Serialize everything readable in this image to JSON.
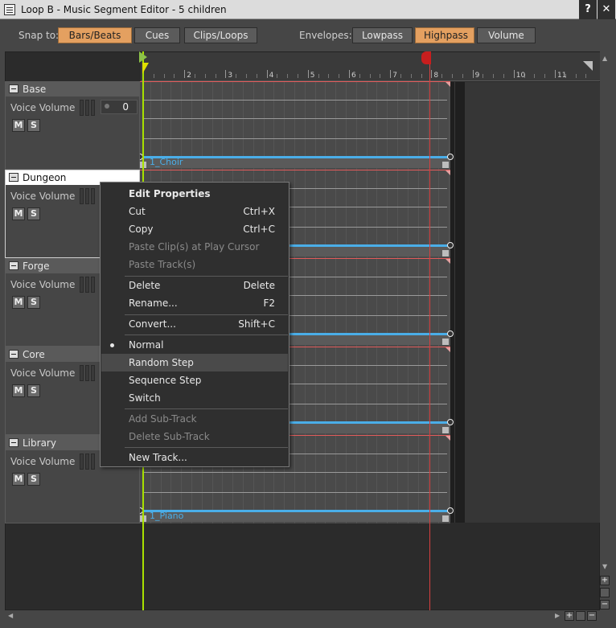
{
  "window": {
    "title": "Loop B - Music Segment Editor - 5 children",
    "help_label": "?",
    "close_label": "✕"
  },
  "toolbar": {
    "snap_label": "Snap to:",
    "snap_options": [
      "Bars/Beats",
      "Cues",
      "Clips/Loops"
    ],
    "snap_selected": "Bars/Beats",
    "envelopes_label": "Envelopes:",
    "envelope_options": [
      "Lowpass",
      "Highpass",
      "Volume"
    ],
    "envelope_selected": "Highpass"
  },
  "ruler": {
    "bar_numbers": [
      "2",
      "3",
      "4",
      "5",
      "6",
      "7",
      "8",
      "9",
      "10",
      "11"
    ]
  },
  "tracks": [
    {
      "name": "Base",
      "param_label": "Voice Volume",
      "value": "0",
      "mute": "M",
      "solo": "S",
      "clip": "1_Choir"
    },
    {
      "name": "Dungeon",
      "param_label": "Voice Volume",
      "mute": "M",
      "solo": "S"
    },
    {
      "name": "Forge",
      "param_label": "Voice Volume",
      "mute": "M",
      "solo": "S"
    },
    {
      "name": "Core",
      "param_label": "Voice Volume",
      "mute": "M",
      "solo": "S"
    },
    {
      "name": "Library",
      "param_label": "Voice Volume",
      "mute": "M",
      "solo": "S",
      "clip": "1_Piano"
    }
  ],
  "context_menu": {
    "items": [
      {
        "label": "Edit Properties",
        "shortcut": "",
        "style": "bold"
      },
      {
        "label": "Cut",
        "shortcut": "Ctrl+X"
      },
      {
        "label": "Copy",
        "shortcut": "Ctrl+C"
      },
      {
        "label": "Paste Clip(s) at Play Cursor",
        "shortcut": "",
        "style": "disabled"
      },
      {
        "label": "Paste Track(s)",
        "shortcut": "",
        "style": "disabled"
      },
      {
        "label": "Delete",
        "shortcut": "Delete"
      },
      {
        "label": "Rename...",
        "shortcut": "F2"
      },
      {
        "label": "Convert...",
        "shortcut": "Shift+C"
      },
      {
        "label": "Normal",
        "shortcut": "",
        "checked": true
      },
      {
        "label": "Random Step",
        "shortcut": "",
        "style": "hover"
      },
      {
        "label": "Sequence Step",
        "shortcut": ""
      },
      {
        "label": "Switch",
        "shortcut": ""
      },
      {
        "label": "Add Sub-Track",
        "shortcut": "",
        "style": "disabled"
      },
      {
        "label": "Delete Sub-Track",
        "shortcut": "",
        "style": "disabled"
      },
      {
        "label": "New Track...",
        "shortcut": ""
      }
    ]
  },
  "colors": {
    "accent_orange": "#e4a060",
    "clip_blue": "#4aaee8",
    "playhead_green": "#a8e000",
    "end_marker_red": "#c81e1e"
  },
  "scroll": {
    "zoom_in": "+",
    "zoom_out": "−"
  }
}
